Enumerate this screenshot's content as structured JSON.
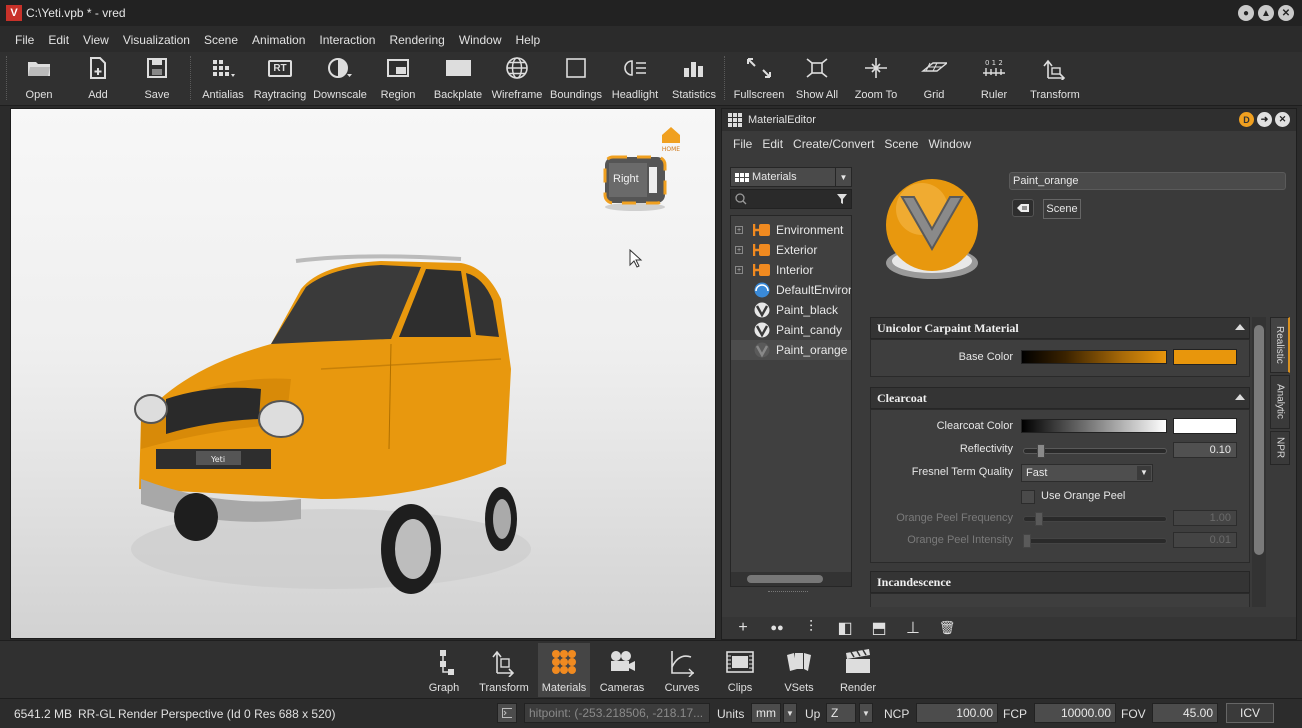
{
  "window": {
    "title": "C:\\Yeti.vpb * - vred",
    "controls": [
      "●",
      "▲",
      "✕"
    ]
  },
  "menubar": [
    "File",
    "Edit",
    "View",
    "Visualization",
    "Scene",
    "Animation",
    "Interaction",
    "Rendering",
    "Window",
    "Help"
  ],
  "toolbar": [
    {
      "label": "Open",
      "icon": "folder-icon"
    },
    {
      "label": "Add",
      "icon": "add-file-icon"
    },
    {
      "label": "Save",
      "icon": "save-icon"
    },
    {
      "label": "Antialias",
      "icon": "antialias-icon"
    },
    {
      "label": "Raytracing",
      "icon": "raytracing-icon",
      "glyph": "RT"
    },
    {
      "label": "Downscale",
      "icon": "downscale-icon"
    },
    {
      "label": "Region",
      "icon": "region-icon"
    },
    {
      "label": "Backplate",
      "icon": "backplate-icon"
    },
    {
      "label": "Wireframe",
      "icon": "wireframe-icon"
    },
    {
      "label": "Boundings",
      "icon": "boundings-icon"
    },
    {
      "label": "Headlight",
      "icon": "headlight-icon"
    },
    {
      "label": "Statistics",
      "icon": "statistics-icon"
    },
    {
      "label": "Fullscreen",
      "icon": "fullscreen-icon"
    },
    {
      "label": "Show All",
      "icon": "show-all-icon"
    },
    {
      "label": "Zoom To",
      "icon": "zoom-to-icon"
    },
    {
      "label": "Grid",
      "icon": "grid-icon"
    },
    {
      "label": "Ruler",
      "icon": "ruler-icon",
      "glyph": "0 1 2"
    },
    {
      "label": "Transform",
      "icon": "transform-icon"
    }
  ],
  "viewport": {
    "viewcube_face": "Right",
    "home_label": "HOME",
    "plate_text": "Yeti"
  },
  "material_editor": {
    "title": "MaterialEditor",
    "controls": [
      "D",
      "➜",
      "✕"
    ],
    "menu": [
      "File",
      "Edit",
      "Create/Convert",
      "Scene",
      "Window"
    ],
    "filter_select": "Materials",
    "search_placeholder": "",
    "tree": [
      {
        "label": "Environment",
        "type": "group"
      },
      {
        "label": "Exterior",
        "type": "group"
      },
      {
        "label": "Interior",
        "type": "group"
      },
      {
        "label": "DefaultEnvironment",
        "type": "env"
      },
      {
        "label": "Paint_black",
        "type": "material"
      },
      {
        "label": "Paint_candy",
        "type": "material"
      },
      {
        "label": "Paint_orange",
        "type": "material",
        "selected": true
      }
    ],
    "material_name": "Paint_orange",
    "scene_button": "Scene",
    "sections": {
      "unicolor": {
        "title": "Unicolor Carpaint Material",
        "base_color_label": "Base Color",
        "base_color": "#e8960c"
      },
      "clearcoat": {
        "title": "Clearcoat",
        "clearcoat_color_label": "Clearcoat Color",
        "clearcoat_color": "#ffffff",
        "reflectivity_label": "Reflectivity",
        "reflectivity": "0.10",
        "reflectivity_fraction": 0.1,
        "fresnel_label": "Fresnel Term Quality",
        "fresnel_value": "Fast",
        "orange_peel_label": "Use Orange Peel",
        "orange_peel_checked": false,
        "op_freq_label": "Orange Peel Frequency",
        "op_freq": "1.00",
        "op_intensity_label": "Orange Peel Intensity",
        "op_intensity": "0.01"
      },
      "incandescence": {
        "title": "Incandescence"
      }
    },
    "side_tabs": [
      "Realistic",
      "Analytic",
      "NPR"
    ],
    "bottom_tools": [
      "+",
      "●●",
      "⫶",
      "◧",
      "⬒",
      "⊥",
      "🗑"
    ]
  },
  "module_bar": [
    {
      "label": "Graph",
      "icon": "graph-icon"
    },
    {
      "label": "Transform",
      "icon": "transform-module-icon"
    },
    {
      "label": "Materials",
      "icon": "materials-icon",
      "active": true
    },
    {
      "label": "Cameras",
      "icon": "cameras-icon"
    },
    {
      "label": "Curves",
      "icon": "curves-icon"
    },
    {
      "label": "Clips",
      "icon": "clips-icon"
    },
    {
      "label": "VSets",
      "icon": "vsets-icon"
    },
    {
      "label": "Render",
      "icon": "render-icon"
    }
  ],
  "status": {
    "memory": "6541.2 MB",
    "renderer": "RR-GL",
    "render_info": "Render Perspective (Id 0 Res 688 x 520)",
    "hitpoint": "hitpoint: (-253.218506, -218.17...",
    "units_label": "Units",
    "units_value": "mm",
    "up_label": "Up",
    "up_value": "Z",
    "ncp_label": "NCP",
    "ncp_value": "100.00",
    "fcp_label": "FCP",
    "fcp_value": "10000.00",
    "fov_label": "FOV",
    "fov_value": "45.00",
    "icv_button": "ICV"
  },
  "colors": {
    "accent": "#f0a020",
    "car_paint": "#e8980e",
    "brand_red": "#c8322a"
  }
}
